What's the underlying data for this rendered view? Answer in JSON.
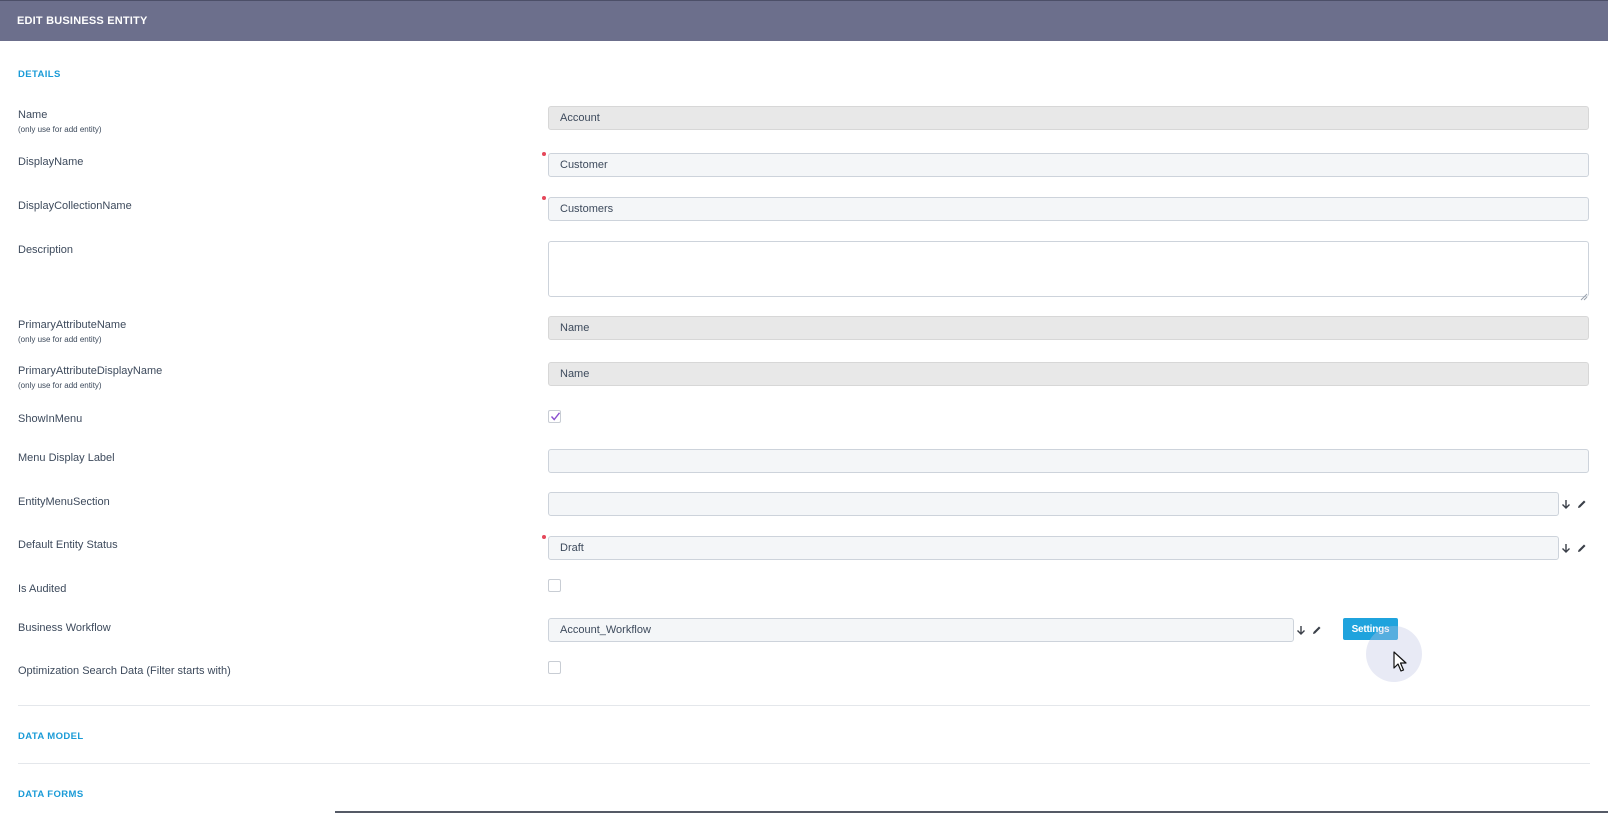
{
  "header": {
    "title": "EDIT BUSINESS ENTITY"
  },
  "sections": {
    "details": "DETAILS",
    "data_model": "DATA MODEL",
    "data_forms": "DATA FORMS"
  },
  "form": {
    "name": {
      "label": "Name",
      "hint": "(only use for add entity)",
      "value": "Account"
    },
    "display_name": {
      "label": "DisplayName",
      "value": "Customer",
      "required": true
    },
    "display_collection_name": {
      "label": "DisplayCollectionName",
      "value": "Customers",
      "required": true
    },
    "description": {
      "label": "Description",
      "value": ""
    },
    "primary_attribute_name": {
      "label": "PrimaryAttributeName",
      "hint": "(only use for add entity)",
      "value": "Name"
    },
    "primary_attribute_display_name": {
      "label": "PrimaryAttributeDisplayName",
      "hint": "(only use for add entity)",
      "value": "Name"
    },
    "show_in_menu": {
      "label": "ShowInMenu",
      "checked": true
    },
    "menu_display_label": {
      "label": "Menu Display Label",
      "value": ""
    },
    "entity_menu_section": {
      "label": "EntityMenuSection",
      "value": ""
    },
    "default_entity_status": {
      "label": "Default Entity Status",
      "value": "Draft",
      "required": true
    },
    "is_audited": {
      "label": "Is Audited",
      "checked": false
    },
    "business_workflow": {
      "label": "Business Workflow",
      "value": "Account_Workflow",
      "settings_label": "Settings"
    },
    "optimization_search_data": {
      "label": "Optimization Search Data (Filter starts with)",
      "checked": false
    }
  },
  "icons": {
    "dropdown": "arrow-down-icon",
    "edit": "pencil-icon",
    "check": "checkmark-icon",
    "cursor": "mouse-pointer-icon"
  },
  "colors": {
    "header_bg": "#6c6f8c",
    "section_title": "#1a9bd7",
    "required_dot": "#e5475a",
    "settings_button": "#1fa3dd",
    "checkmark": "#8a4fd0"
  }
}
